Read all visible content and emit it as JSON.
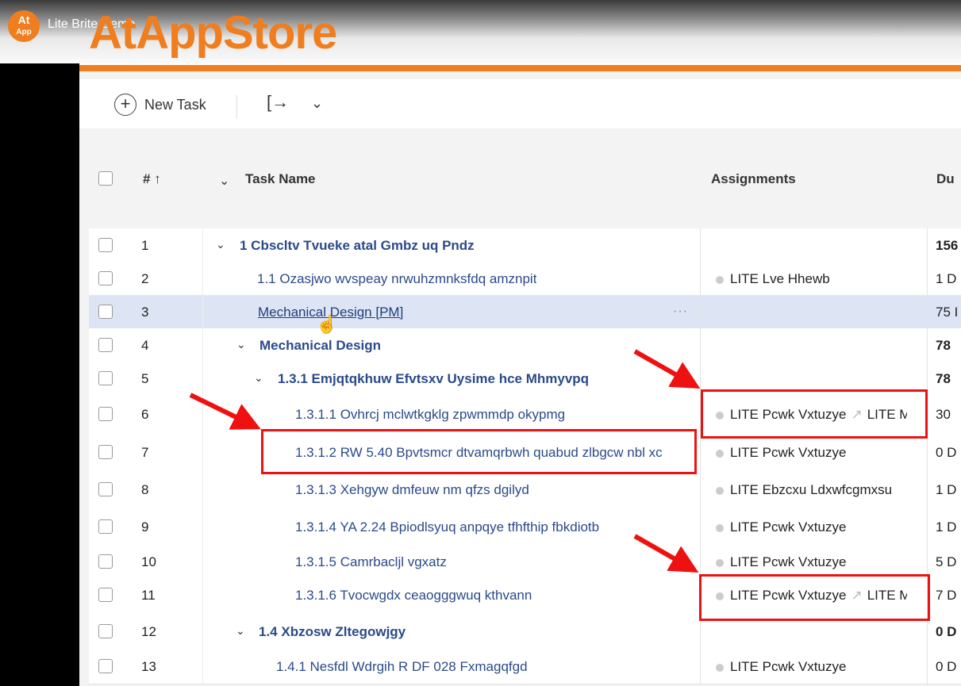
{
  "video": {
    "title": "Lite Brite Demo",
    "logo_top": "At",
    "logo_bottom": "App"
  },
  "brand": "AtAppStore",
  "toolbar": {
    "new_task": "New Task",
    "export_glyph": "[→",
    "chevron": "⌄"
  },
  "columns": {
    "number": "# ↑",
    "task_name": "Task Name",
    "assignments": "Assignments",
    "duration": "Du"
  },
  "rows": [
    {
      "num": "1",
      "name": "1 Cbscltv Tvueke atal Gmbz uq Pndz",
      "assign": "",
      "dur": "156"
    },
    {
      "num": "2",
      "name": "1.1 Ozasjwo wvspeay nrwuhzmnksfdq amznpit",
      "assign": "LITE Lve Hhewb",
      "dur": "1 D"
    },
    {
      "num": "3",
      "name": "Mechanical Design [PM]",
      "assign": "",
      "dur": "75 I"
    },
    {
      "num": "4",
      "name": "Mechanical Design",
      "assign": "",
      "dur": "78"
    },
    {
      "num": "5",
      "name": "1.3.1 Emjqtqkhuw Efvtsxv Uysime hce Mhmyvpq",
      "assign": "",
      "dur": "78"
    },
    {
      "num": "6",
      "name": "1.3.1.1 Ovhrcj mclwtkgklg zpwmmdp okypmg",
      "assign": "LITE Pcwk Vxtuzye",
      "assign2": "LITE M",
      "dur": "30"
    },
    {
      "num": "7",
      "name": "1.3.1.2 RW 5.40 Bpvtsmcr dtvamqrbwh quabud zlbgcw nbl xc",
      "assign": "LITE Pcwk Vxtuzye",
      "dur": "0 D"
    },
    {
      "num": "8",
      "name": "1.3.1.3 Xehgyw dmfeuw nm qfzs dgilyd",
      "assign": "LITE Ebzcxu Ldxwfcgmxsu",
      "dur": "1 D"
    },
    {
      "num": "9",
      "name": "1.3.1.4 YA 2.24 Bpiodlsyuq anpqye tfhfthip fbkdiotb",
      "assign": "LITE Pcwk Vxtuzye",
      "dur": "1 D"
    },
    {
      "num": "10",
      "name": "1.3.1.5 Camrbacljl vgxatz",
      "assign": "LITE Pcwk Vxtuzye",
      "dur": "5 D"
    },
    {
      "num": "11",
      "name": "1.3.1.6 Tvocwgdx ceaogggwuq kthvann",
      "assign": "LITE Pcwk Vxtuzye",
      "assign2": "LITE M",
      "dur": "7 D"
    },
    {
      "num": "12",
      "name": "1.4 Xbzosw Zltegowjgy",
      "assign": "",
      "dur": "0 D"
    },
    {
      "num": "13",
      "name": "1.4.1 Nesfdl Wdrgih R DF 028 Fxmagqfgd",
      "assign": "LITE Pcwk Vxtuzye",
      "dur": "0 D"
    }
  ],
  "more_glyph": "···",
  "caret": "⌄",
  "colors": {
    "brand": "#f07d1e",
    "link": "#2b4a8a",
    "highlight": "#e11111",
    "selected_row": "#dde5f5"
  }
}
